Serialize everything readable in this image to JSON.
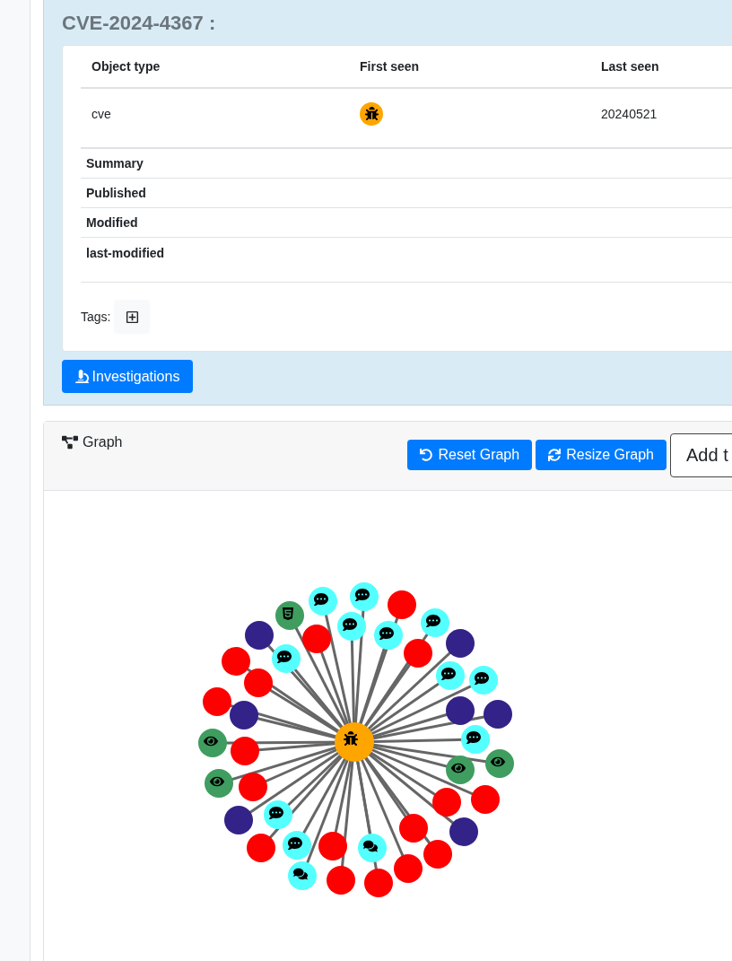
{
  "title": "CVE-2024-4367 :",
  "object_table": {
    "columns": [
      "Object type",
      "First seen",
      "Last seen"
    ],
    "row": {
      "object_type": "cve",
      "last_seen": "20240521"
    }
  },
  "details": [
    "Summary",
    "Published",
    "Modified",
    "last-modified"
  ],
  "tags_label": "Tags:",
  "investigations_button": "Investigations",
  "graph": {
    "title": "Graph",
    "buttons": [
      {
        "kind": "reset",
        "label": "Reset Graph"
      },
      {
        "kind": "resize",
        "label": "Resize Graph"
      },
      {
        "kind": "add",
        "label": "Add t"
      }
    ]
  }
}
